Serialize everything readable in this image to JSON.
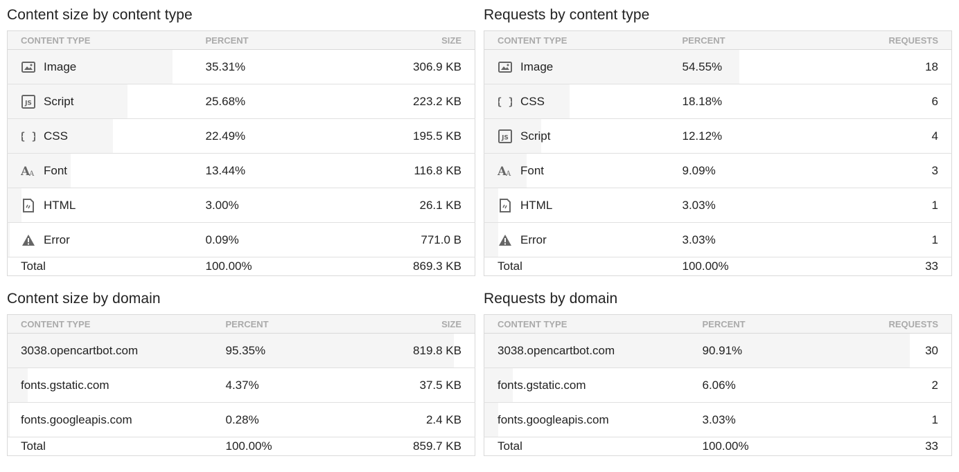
{
  "panels": {
    "size_by_type": {
      "title": "Content size by content type",
      "headers": [
        "CONTENT TYPE",
        "PERCENT",
        "SIZE"
      ],
      "rows": [
        {
          "icon": "image-icon",
          "label": "Image",
          "percent": "35.31%",
          "value": "306.9 KB",
          "share": 0.3531
        },
        {
          "icon": "script-icon",
          "label": "Script",
          "percent": "25.68%",
          "value": "223.2 KB",
          "share": 0.2568
        },
        {
          "icon": "css-icon",
          "label": "CSS",
          "percent": "22.49%",
          "value": "195.5 KB",
          "share": 0.2249
        },
        {
          "icon": "font-icon",
          "label": "Font",
          "percent": "13.44%",
          "value": "116.8 KB",
          "share": 0.1344
        },
        {
          "icon": "html-icon",
          "label": "HTML",
          "percent": "3.00%",
          "value": "26.1 KB",
          "share": 0.03
        },
        {
          "icon": "warning-icon",
          "label": "Error",
          "percent": "0.09%",
          "value": "771.0 B",
          "share": 0.0009
        }
      ],
      "total": {
        "label": "Total",
        "percent": "100.00%",
        "value": "869.3 KB"
      }
    },
    "requests_by_type": {
      "title": "Requests by content type",
      "headers": [
        "CONTENT TYPE",
        "PERCENT",
        "REQUESTS"
      ],
      "rows": [
        {
          "icon": "image-icon",
          "label": "Image",
          "percent": "54.55%",
          "value": "18",
          "share": 0.5455
        },
        {
          "icon": "css-icon",
          "label": "CSS",
          "percent": "18.18%",
          "value": "6",
          "share": 0.1818
        },
        {
          "icon": "script-icon",
          "label": "Script",
          "percent": "12.12%",
          "value": "4",
          "share": 0.1212
        },
        {
          "icon": "font-icon",
          "label": "Font",
          "percent": "9.09%",
          "value": "3",
          "share": 0.0909
        },
        {
          "icon": "html-icon",
          "label": "HTML",
          "percent": "3.03%",
          "value": "1",
          "share": 0.0303
        },
        {
          "icon": "warning-icon",
          "label": "Error",
          "percent": "3.03%",
          "value": "1",
          "share": 0.0303
        }
      ],
      "total": {
        "label": "Total",
        "percent": "100.00%",
        "value": "33"
      }
    },
    "size_by_domain": {
      "title": "Content size by domain",
      "headers": [
        "CONTENT TYPE",
        "PERCENT",
        "SIZE"
      ],
      "rows": [
        {
          "label": "3038.opencartbot.com",
          "percent": "95.35%",
          "value": "819.8 KB",
          "share": 0.9535
        },
        {
          "label": "fonts.gstatic.com",
          "percent": "4.37%",
          "value": "37.5 KB",
          "share": 0.0437
        },
        {
          "label": "fonts.googleapis.com",
          "percent": "0.28%",
          "value": "2.4 KB",
          "share": 0.0028
        }
      ],
      "total": {
        "label": "Total",
        "percent": "100.00%",
        "value": "859.7 KB"
      }
    },
    "requests_by_domain": {
      "title": "Requests by domain",
      "headers": [
        "CONTENT TYPE",
        "PERCENT",
        "REQUESTS"
      ],
      "rows": [
        {
          "label": "3038.opencartbot.com",
          "percent": "90.91%",
          "value": "30",
          "share": 0.9091
        },
        {
          "label": "fonts.gstatic.com",
          "percent": "6.06%",
          "value": "2",
          "share": 0.0606
        },
        {
          "label": "fonts.googleapis.com",
          "percent": "3.03%",
          "value": "1",
          "share": 0.0303
        }
      ],
      "total": {
        "label": "Total",
        "percent": "100.00%",
        "value": "33"
      }
    }
  }
}
